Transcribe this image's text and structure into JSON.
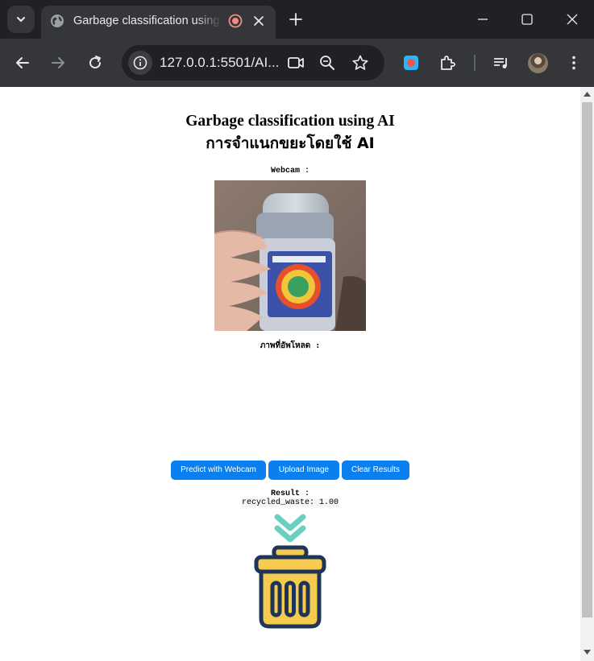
{
  "browser": {
    "tab_title": "Garbage classification using AI",
    "url": "127.0.0.1:5501/AI..."
  },
  "page": {
    "heading_en": "Garbage classification using AI",
    "heading_th": "การจำแนกขยะโดยใช้ AI",
    "webcam_label": "Webcam :",
    "upload_label": "ภาพที่อัพโหลด :",
    "buttons": {
      "predict_webcam": "Predict with Webcam",
      "upload_image": "Upload Image",
      "clear_results": "Clear Results"
    },
    "result_label": "Result :",
    "result_value": "recycled_waste: 1.00"
  },
  "colors": {
    "button_bg": "#0a80f0",
    "bin_body": "#f6cc50",
    "bin_outline": "#1f3557",
    "arrow": "#6ad0c4"
  },
  "icons": [
    "tab-list-icon",
    "globe-icon",
    "recording-icon",
    "close-icon",
    "plus-icon",
    "minimize-icon",
    "maximize-icon",
    "back-icon",
    "forward-icon",
    "reload-icon",
    "site-info-icon",
    "camera-icon",
    "zoom-icon",
    "star-icon",
    "extension-record-icon",
    "puzzle-icon",
    "media-icon",
    "avatar",
    "more-icon",
    "trash-bin-icon",
    "double-chevron-down-icon"
  ]
}
